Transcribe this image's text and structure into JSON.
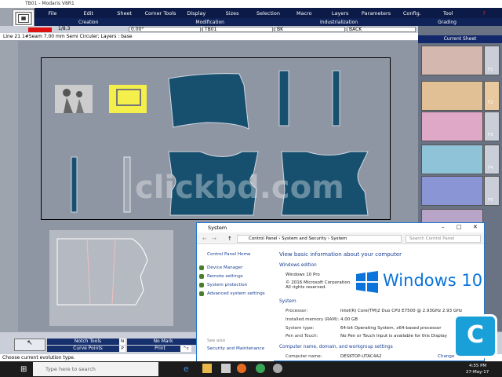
{
  "window": {
    "title": "TB01 - Modaris V8R1"
  },
  "menu": [
    "File",
    "Edit",
    "Sheet",
    "Corner Tools",
    "Display",
    "Sizes",
    "Selection",
    "Macro",
    "Layers",
    "Parameters",
    "Config.",
    "Tool",
    "?"
  ],
  "subheader": {
    "creation": "Creation",
    "modification": "Modification",
    "industrialization": "Industrialization",
    "grading": "Grading"
  },
  "toolrow": {
    "size": "1/8.3",
    "angle": "0.00°",
    "code": "TB01",
    "ref": "BK",
    "fabric": "BACK"
  },
  "status_line": "Line 21 1#Seam 7.00 mm Semi Circuler;   Layers : base",
  "right_panel": {
    "title": "Current Sheet",
    "keys": [
      "F1",
      "F2",
      "F3",
      "F4",
      "F5"
    ]
  },
  "bottom": {
    "notch_tools": "Notch Tools",
    "notch_key": "N",
    "no_mark": "No Mark",
    "curve_points": "Curve Points",
    "curve_key": "P",
    "print": "Print",
    "print_key": "^c"
  },
  "hint": "Choose current evolution type.",
  "watermark": "clickbd.com",
  "taskbar": {
    "search_placeholder": "Type here to search",
    "time": "4:55 PM",
    "date": "27-May-17"
  },
  "system_dialog": {
    "title": "System",
    "breadcrumb": [
      "Control Panel",
      "System and Security",
      "System"
    ],
    "search_placeholder": "Search Control Panel",
    "left_home": "Control Panel Home",
    "left_links": [
      "Device Manager",
      "Remote settings",
      "System protection",
      "Advanced system settings"
    ],
    "see_also": "See also",
    "security": "Security and Maintenance",
    "heading": "View basic information about your computer",
    "edition_label": "Windows edition",
    "edition": "Windows 10 Pro",
    "copyright": "© 2016 Microsoft Corporation. All rights reserved.",
    "logo_text": "Windows 10",
    "system_label": "System",
    "rows": [
      {
        "k": "Processor:",
        "v": "Intel(R) Core(TM)2 Duo CPU    E7500 @ 2.93GHz   2.93 GHz"
      },
      {
        "k": "Installed memory (RAM):",
        "v": "4.00 GB"
      },
      {
        "k": "System type:",
        "v": "64-bit Operating System, x64-based processor"
      },
      {
        "k": "Pen and Touch:",
        "v": "No Pen or Touch Input is available for this Display"
      }
    ],
    "computer_label": "Computer name, domain, and workgroup settings",
    "computer_name_k": "Computer name:",
    "computer_name_v": "DESKTOP-UTAC4A2",
    "change": "Change"
  }
}
